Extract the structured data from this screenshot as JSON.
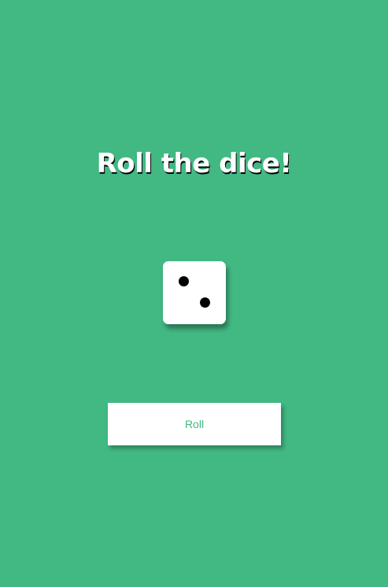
{
  "page": {
    "title": "Roll the dice!"
  },
  "die": {
    "face_value": 2,
    "color": "#ffffff",
    "pip_color": "#000000"
  },
  "controls": {
    "roll_label": "Roll"
  },
  "theme": {
    "background": "#42b883",
    "accent": "#42b883",
    "title_color": "#ffffff"
  }
}
